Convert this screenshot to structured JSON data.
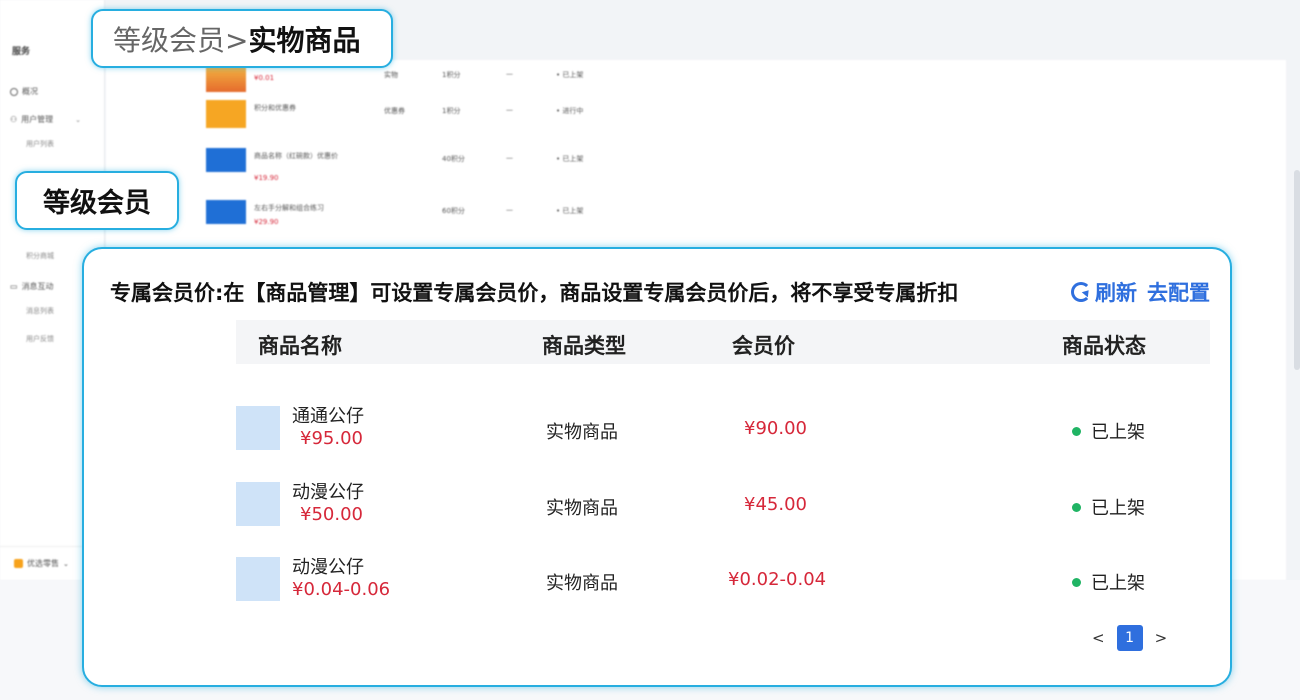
{
  "callouts": {
    "top_prefix": "等级会员>",
    "top_bold": "实物商品",
    "left": "等级会员"
  },
  "background": {
    "sidebar_title": "服务",
    "sidebar_items": [
      "概况",
      "用户管理",
      "用户列表"
    ],
    "sidebar_items_lower": [
      "积分商城",
      "消息互动",
      "消息列表",
      "用户反馈"
    ],
    "bottom_label": "优选零售",
    "rows": [
      {
        "name": "",
        "price": "¥0.01",
        "type": "实物",
        "points": "1积分",
        "dash": "—",
        "status": "已上架"
      },
      {
        "name": "积分和优惠券",
        "price": "",
        "type": "优惠券",
        "points": "1积分",
        "dash": "—",
        "status": "进行中"
      },
      {
        "name": "商品名称（红碗款）优惠价",
        "price": "¥19.90",
        "type": "",
        "points": "40积分",
        "dash": "—",
        "status": "已上架"
      },
      {
        "name": "左右手分解和组合练习",
        "price": "¥29.90",
        "type": "",
        "points": "60积分",
        "dash": "—",
        "status": "已上架"
      }
    ]
  },
  "panel": {
    "notice": "专属会员价:在【商品管理】可设置专属会员价，商品设置专属会员价后，将不享受专属折扣",
    "refresh_label": "刷新",
    "config_label": "去配置",
    "columns": [
      "商品名称",
      "商品类型",
      "会员价",
      "商品状态"
    ],
    "rows": [
      {
        "name": "通通公仔",
        "price": "¥95.00",
        "type": "实物商品",
        "member_price": "¥90.00",
        "status": "已上架"
      },
      {
        "name": "动漫公仔",
        "price": "¥50.00",
        "type": "实物商品",
        "member_price": "¥45.00",
        "status": "已上架"
      },
      {
        "name": "动漫公仔",
        "price": "¥0.04-0.06",
        "type": "实物商品",
        "member_price": "¥0.02-0.04",
        "status": "已上架"
      }
    ],
    "pager": {
      "prev": "<",
      "current": "1",
      "next": ">"
    }
  },
  "colors": {
    "accent": "#27aee0",
    "link": "#2f6fde",
    "price": "#d6283a",
    "status_dot": "#20b464"
  }
}
